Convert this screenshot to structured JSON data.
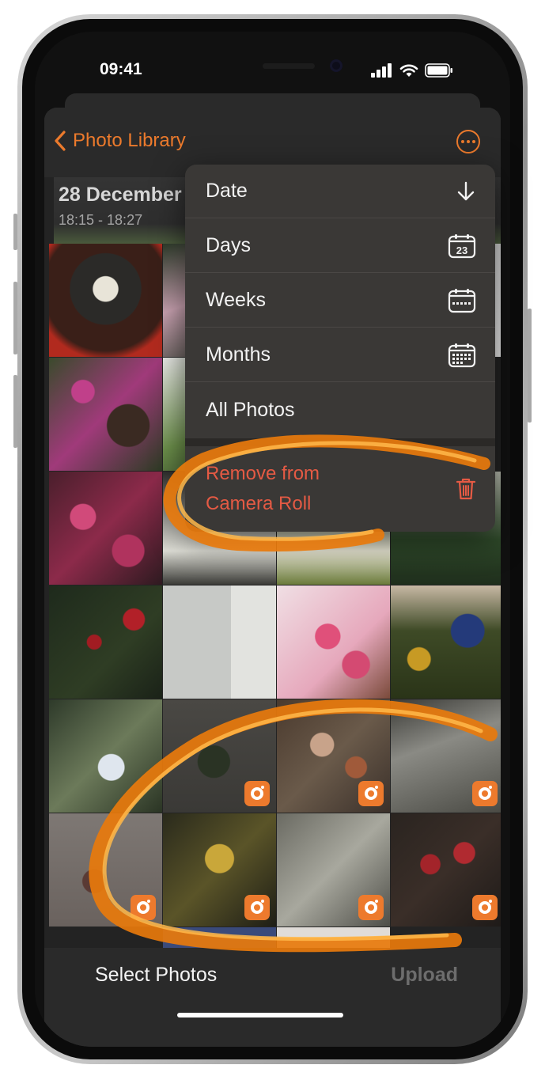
{
  "status_bar": {
    "time": "09:41"
  },
  "nav": {
    "back_label": "Photo Library"
  },
  "section": {
    "date": "28 December",
    "time_range": "18:15 - 18:27"
  },
  "menu": {
    "items": [
      {
        "label": "Date",
        "icon": "arrow-down-icon"
      },
      {
        "label": "Days",
        "icon": "calendar-day-icon",
        "badge": "23"
      },
      {
        "label": "Weeks",
        "icon": "calendar-week-icon"
      },
      {
        "label": "Months",
        "icon": "calendar-month-icon"
      },
      {
        "label": "All Photos",
        "icon": ""
      }
    ],
    "danger": {
      "label_line1": "Remove from",
      "label_line2": "Camera Roll",
      "icon": "trash-icon"
    }
  },
  "bottom_bar": {
    "select_label": "Select Photos",
    "upload_label": "Upload"
  },
  "colors": {
    "accent": "#ec7a2c",
    "danger": "#e55a44",
    "upload_disabled": "#6d6d6d",
    "highlight_stroke": "#f08a14"
  }
}
